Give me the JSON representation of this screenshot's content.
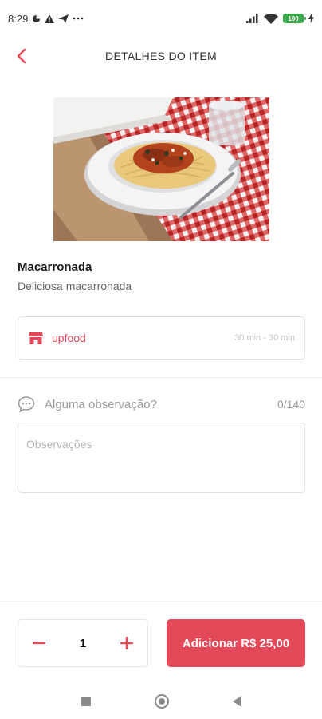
{
  "status_bar": {
    "time": "8:29",
    "battery": "100"
  },
  "header": {
    "title": "DETALHES DO ITEM"
  },
  "item": {
    "name": "Macarronada",
    "description": "Deliciosa macarronada"
  },
  "restaurant": {
    "name": "upfood",
    "delivery_time": "30 min - 30 min"
  },
  "observation": {
    "label": "Alguma observação?",
    "counter": "0/140",
    "placeholder": "Observações",
    "value": ""
  },
  "cart": {
    "quantity": "1",
    "add_label": "Adicionar R$ 25,00"
  },
  "colors": {
    "accent": "#e34a59"
  }
}
